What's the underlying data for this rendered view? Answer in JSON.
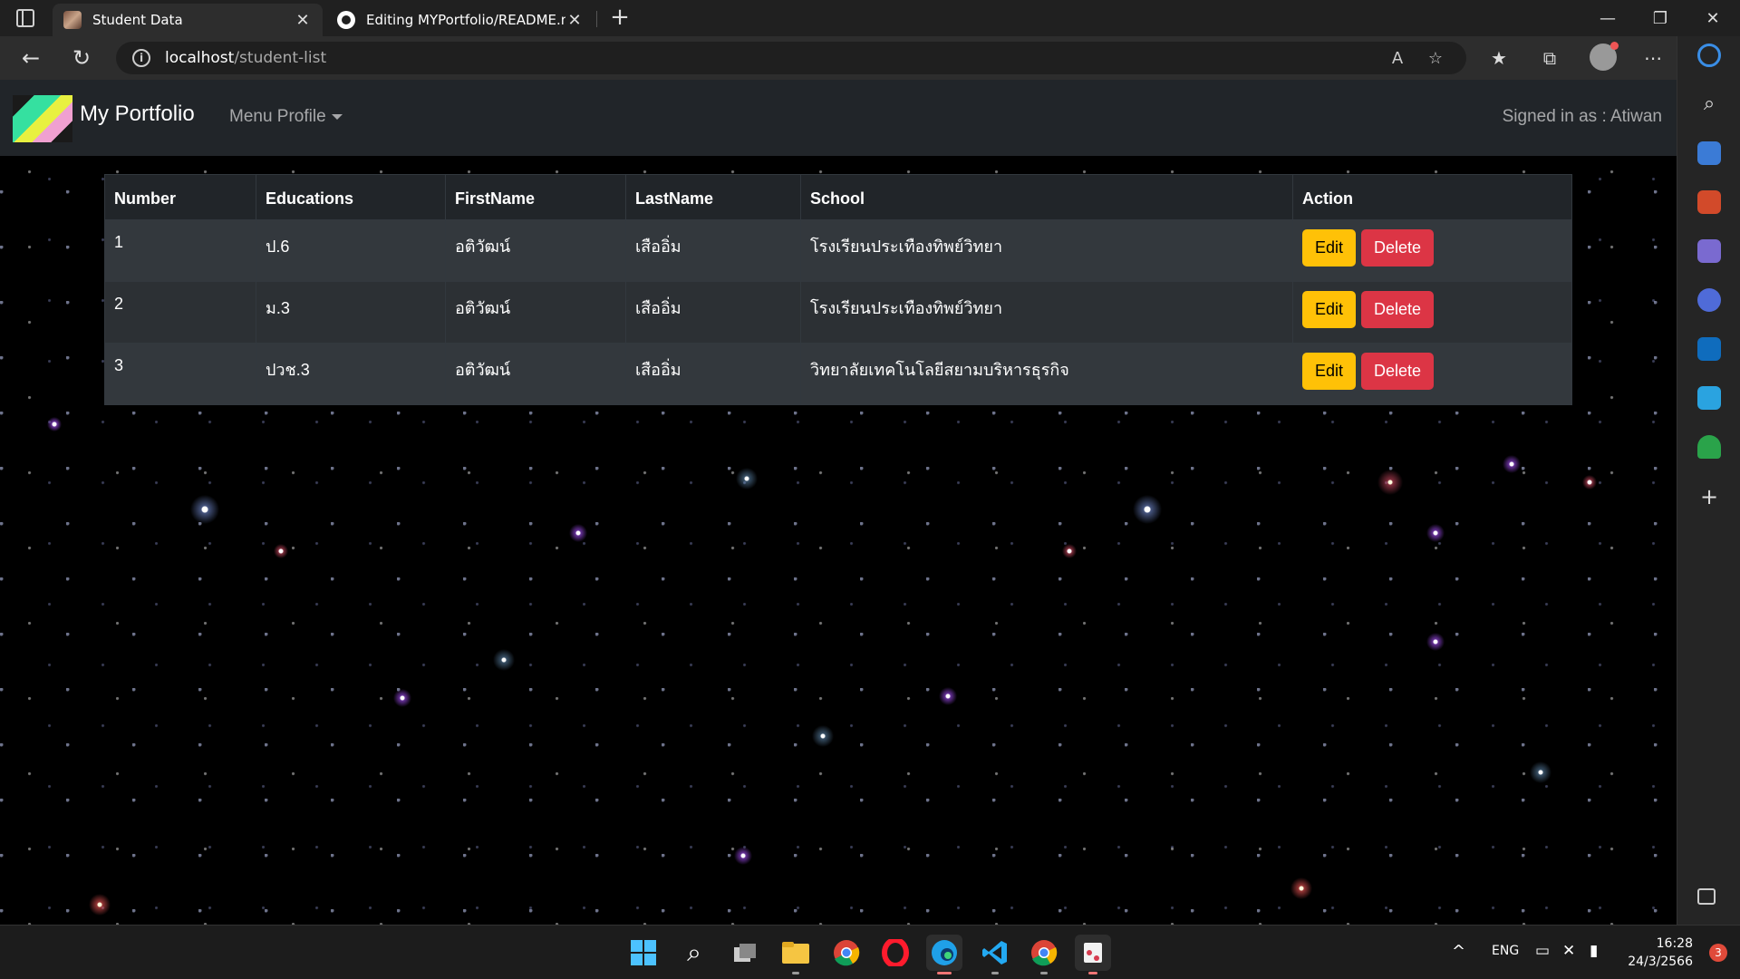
{
  "browser": {
    "tabs": [
      {
        "title": "Student Data",
        "active": true
      },
      {
        "title": "Editing MYPortfolio/README.md",
        "active": false
      }
    ],
    "url_host": "localhost",
    "url_path": "/student-list"
  },
  "site": {
    "brand": "My Portfolio",
    "menu": "Menu Profile",
    "signed_in": "Signed in as : Atiwan"
  },
  "table": {
    "headers": [
      "Number",
      "Educations",
      "FirstName",
      "LastName",
      "School",
      "Action"
    ],
    "rows": [
      {
        "number": "1",
        "education": "ป.6",
        "firstname": "อติวัฒน์",
        "lastname": "เสืออิ่ม",
        "school": "โรงเรียนประเทืองทิพย์วิทยา"
      },
      {
        "number": "2",
        "education": "ม.3",
        "firstname": "อติวัฒน์",
        "lastname": "เสืออิ่ม",
        "school": "โรงเรียนประเทืองทิพย์วิทยา"
      },
      {
        "number": "3",
        "education": "ปวช.3",
        "firstname": "อติวัฒน์",
        "lastname": "เสืออิ่ม",
        "school": "วิทยาลัยเทคโนโลยีสยามบริหารธุรกิจ"
      }
    ],
    "edit_label": "Edit",
    "delete_label": "Delete"
  },
  "taskbar": {
    "language": "ENG",
    "time": "16:28",
    "date": "24/3/2566",
    "notification_count": "3"
  },
  "colors": {
    "edit": "#ffc107",
    "delete": "#dc3545",
    "navbar": "#212529"
  }
}
